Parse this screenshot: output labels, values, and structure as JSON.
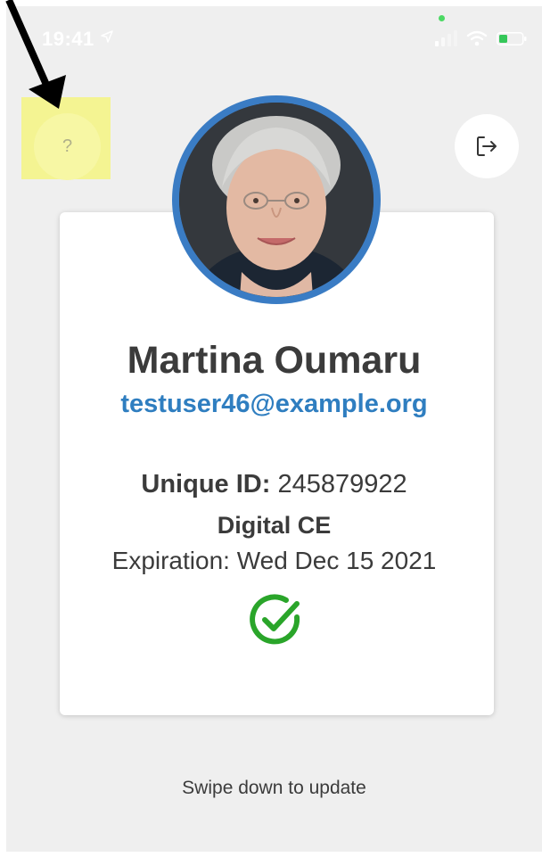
{
  "status_bar": {
    "time": "19:41"
  },
  "help": {
    "label": "?"
  },
  "profile": {
    "name": "Martina Oumaru",
    "email": "testuser46@example.org",
    "unique_id_label": "Unique ID:",
    "unique_id_value": " 245879922",
    "certificate": "Digital CE",
    "expiration": "Expiration: Wed Dec 15 2021",
    "status_color": "#2aa52a",
    "avatar_ring_color": "#3a7cc4"
  },
  "footer": {
    "swipe_hint": "Swipe down to update"
  },
  "icons": {
    "help": "question-mark",
    "logout": "logout-arrow",
    "status": "check-circle"
  }
}
